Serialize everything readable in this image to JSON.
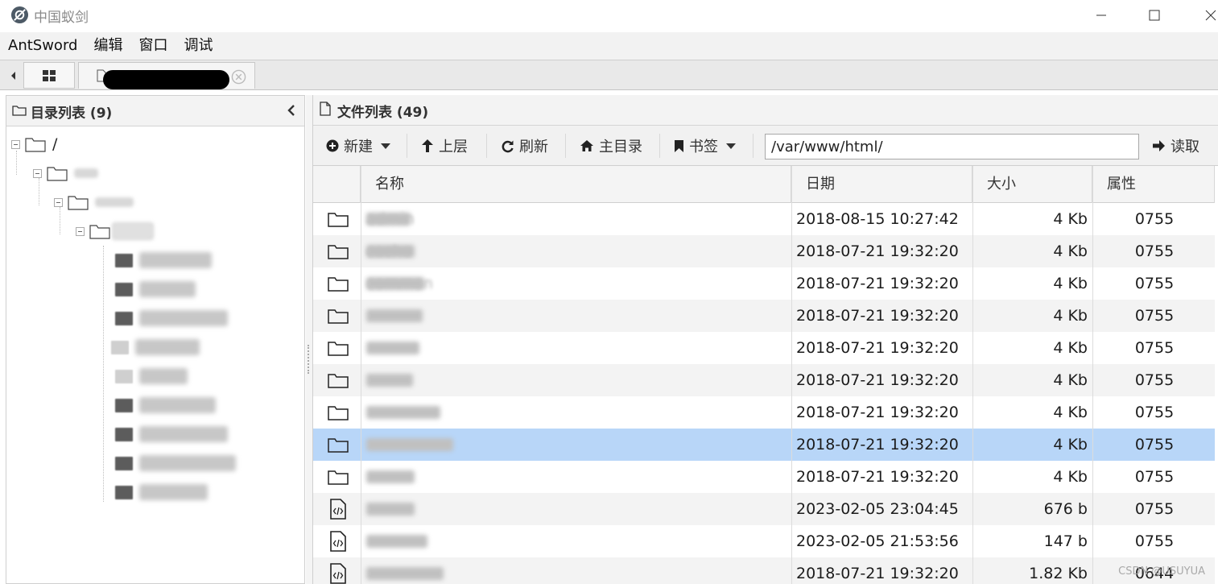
{
  "window": {
    "title": "中国蚁剑"
  },
  "menu": [
    "AntSword",
    "编辑",
    "窗口",
    "调试"
  ],
  "tabs": {
    "site_tab_title": "redacted"
  },
  "left_panel": {
    "title": "目录列表 (9)",
    "tree_root": "/"
  },
  "right_panel": {
    "title": "文件列表 (49)",
    "toolbar": {
      "new_label": "新建",
      "up_label": "上层",
      "refresh_label": "刷新",
      "home_label": "主目录",
      "bookmark_label": "书签",
      "path_value": "/var/www/html/",
      "read_label": "读取"
    },
    "columns": [
      "名称",
      "日期",
      "大小",
      "属性"
    ],
    "rows": [
      {
        "type": "folder",
        "name": "admin",
        "date": "2018-08-15 10:27:42",
        "size": "4 Kb",
        "attr": "0755"
      },
      {
        "type": "folder",
        "name": "cache",
        "date": "2018-07-21 19:32:20",
        "size": "4 Kb",
        "attr": "0755"
      },
      {
        "type": "folder",
        "name": "common",
        "date": "2018-07-21 19:32:20",
        "size": "4 Kb",
        "attr": "0755"
      },
      {
        "type": "folder",
        "name": "",
        "date": "2018-07-21 19:32:20",
        "size": "4 Kb",
        "attr": "0755"
      },
      {
        "type": "folder",
        "name": "",
        "date": "2018-07-21 19:32:20",
        "size": "4 Kb",
        "attr": "0755"
      },
      {
        "type": "folder",
        "name": "",
        "date": "2018-07-21 19:32:20",
        "size": "4 Kb",
        "attr": "0755"
      },
      {
        "type": "folder",
        "name": "",
        "date": "2018-07-21 19:32:20",
        "size": "4 Kb",
        "attr": "0755"
      },
      {
        "type": "folder",
        "name": "",
        "date": "2018-07-21 19:32:20",
        "size": "4 Kb",
        "attr": "0755",
        "selected": true
      },
      {
        "type": "folder",
        "name": "",
        "date": "2018-07-21 19:32:20",
        "size": "4 Kb",
        "attr": "0755"
      },
      {
        "type": "code",
        "name": "",
        "date": "2023-02-05 23:04:45",
        "size": "676 b",
        "attr": "0755"
      },
      {
        "type": "code",
        "name": "",
        "date": "2023-02-05 21:53:56",
        "size": "147 b",
        "attr": "0755"
      },
      {
        "type": "code",
        "name": "",
        "date": "2018-07-21 19:32:20",
        "size": "1.82 Kb",
        "attr": "0644"
      }
    ]
  },
  "watermark": "CSDN @USUYUA",
  "colors": {
    "selected_row": "#b8d6f8",
    "alt_row": "#f3f3f3",
    "header_bg": "#f3f3f3"
  }
}
